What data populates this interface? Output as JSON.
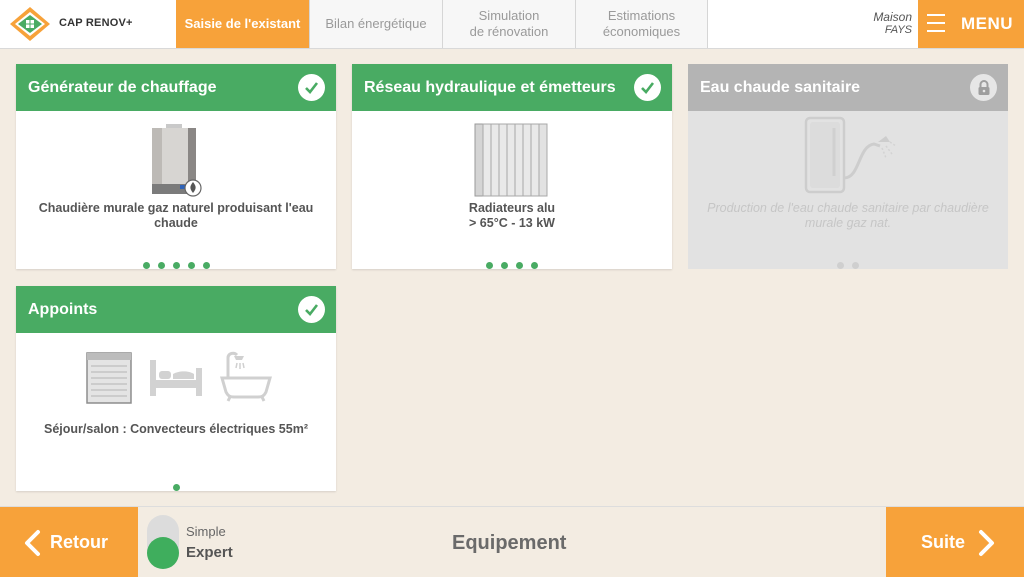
{
  "brand": {
    "name": "CAP RENOV+"
  },
  "tabs": [
    {
      "label": "Saisie de l'existant",
      "active": true
    },
    {
      "label": "Bilan énergétique",
      "active": false
    },
    {
      "label": "Simulation\nde rénovation",
      "active": false
    },
    {
      "label": "Estimations\néconomiques",
      "active": false
    }
  ],
  "house": {
    "type": "Maison",
    "owner": "FAYS"
  },
  "menu": {
    "label": "MENU"
  },
  "cards": [
    {
      "title": "Générateur de chauffage",
      "status": "completed",
      "description": "Chaudière murale gaz naturel produisant l'eau chaude",
      "dots": 5,
      "icon": "boiler-image"
    },
    {
      "title": "Réseau hydraulique et émetteurs",
      "status": "completed",
      "description": "Radiateurs alu\n> 65°C - 13 kW",
      "dots": 4,
      "icon": "radiator-image"
    },
    {
      "title": "Eau chaude sanitaire",
      "status": "locked",
      "description": "Production de l'eau chaude sanitaire par chaudière murale gaz nat.",
      "dots": 2,
      "icon": "water-heater-image"
    },
    {
      "title": "Appoints",
      "status": "completed",
      "description": "Séjour/salon : Convecteurs électriques 55m²",
      "dots": 1,
      "icon": "convector-image"
    }
  ],
  "footer": {
    "back_label": "Retour",
    "next_label": "Suite",
    "mode_simple": "Simple",
    "mode_expert": "Expert",
    "mode_selected": "Expert",
    "page_title": "Equipement"
  },
  "colors": {
    "accent": "#f7a23a",
    "green": "#49ab63",
    "background": "#f3ece2",
    "disabled": "#b4b4b4"
  }
}
